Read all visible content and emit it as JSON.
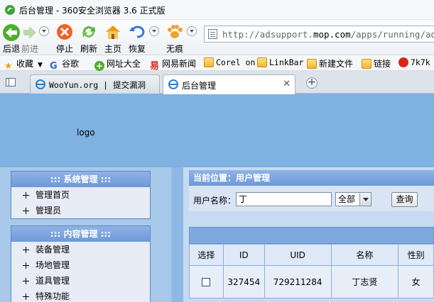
{
  "window": {
    "title": "后台管理 - 360安全浏览器 3.6 正式版"
  },
  "toolbar": {
    "back": "后退",
    "forward": "前进",
    "stop": "停止",
    "refresh": "刷新",
    "home": "主页",
    "restore": "恢复",
    "incognito": "无痕"
  },
  "address": {
    "url_prefix": "http://adsupport.",
    "url_domain": "mop.com",
    "url_suffix": "/apps/running/admin"
  },
  "favorites": {
    "collect": "收藏",
    "items": [
      "谷歌",
      "网址大全",
      "网易新闻",
      "Corel on",
      "LinkBar",
      "新建文件",
      "链接",
      "7k7k"
    ]
  },
  "tabs": [
    {
      "label": "WooYun.org | 提交漏洞"
    },
    {
      "label": "后台管理"
    }
  ],
  "page": {
    "logo": "logo",
    "sidebar": {
      "system": {
        "title": "::: 系统管理 :::",
        "items": [
          "管理首页",
          "管理员"
        ]
      },
      "content": {
        "title": "::: 内容管理 :::",
        "items": [
          "装备管理",
          "场地管理",
          "道具管理",
          "特殊功能"
        ]
      }
    },
    "breadcrumb": "当前位置：用户管理",
    "search": {
      "label": "用户名称：",
      "value": "丁",
      "select": "全部",
      "button": "查询"
    },
    "table": {
      "headers": [
        "选择",
        "ID",
        "UID",
        "名称",
        "性别"
      ],
      "rows": [
        {
          "id": "327454",
          "uid": "729211284",
          "name": "丁志贤",
          "gender": "女"
        }
      ]
    }
  },
  "colors": {
    "page_bg": "#7fb1e1",
    "panel_header": "#7fa6e0",
    "tab_active": "#ffffff"
  }
}
